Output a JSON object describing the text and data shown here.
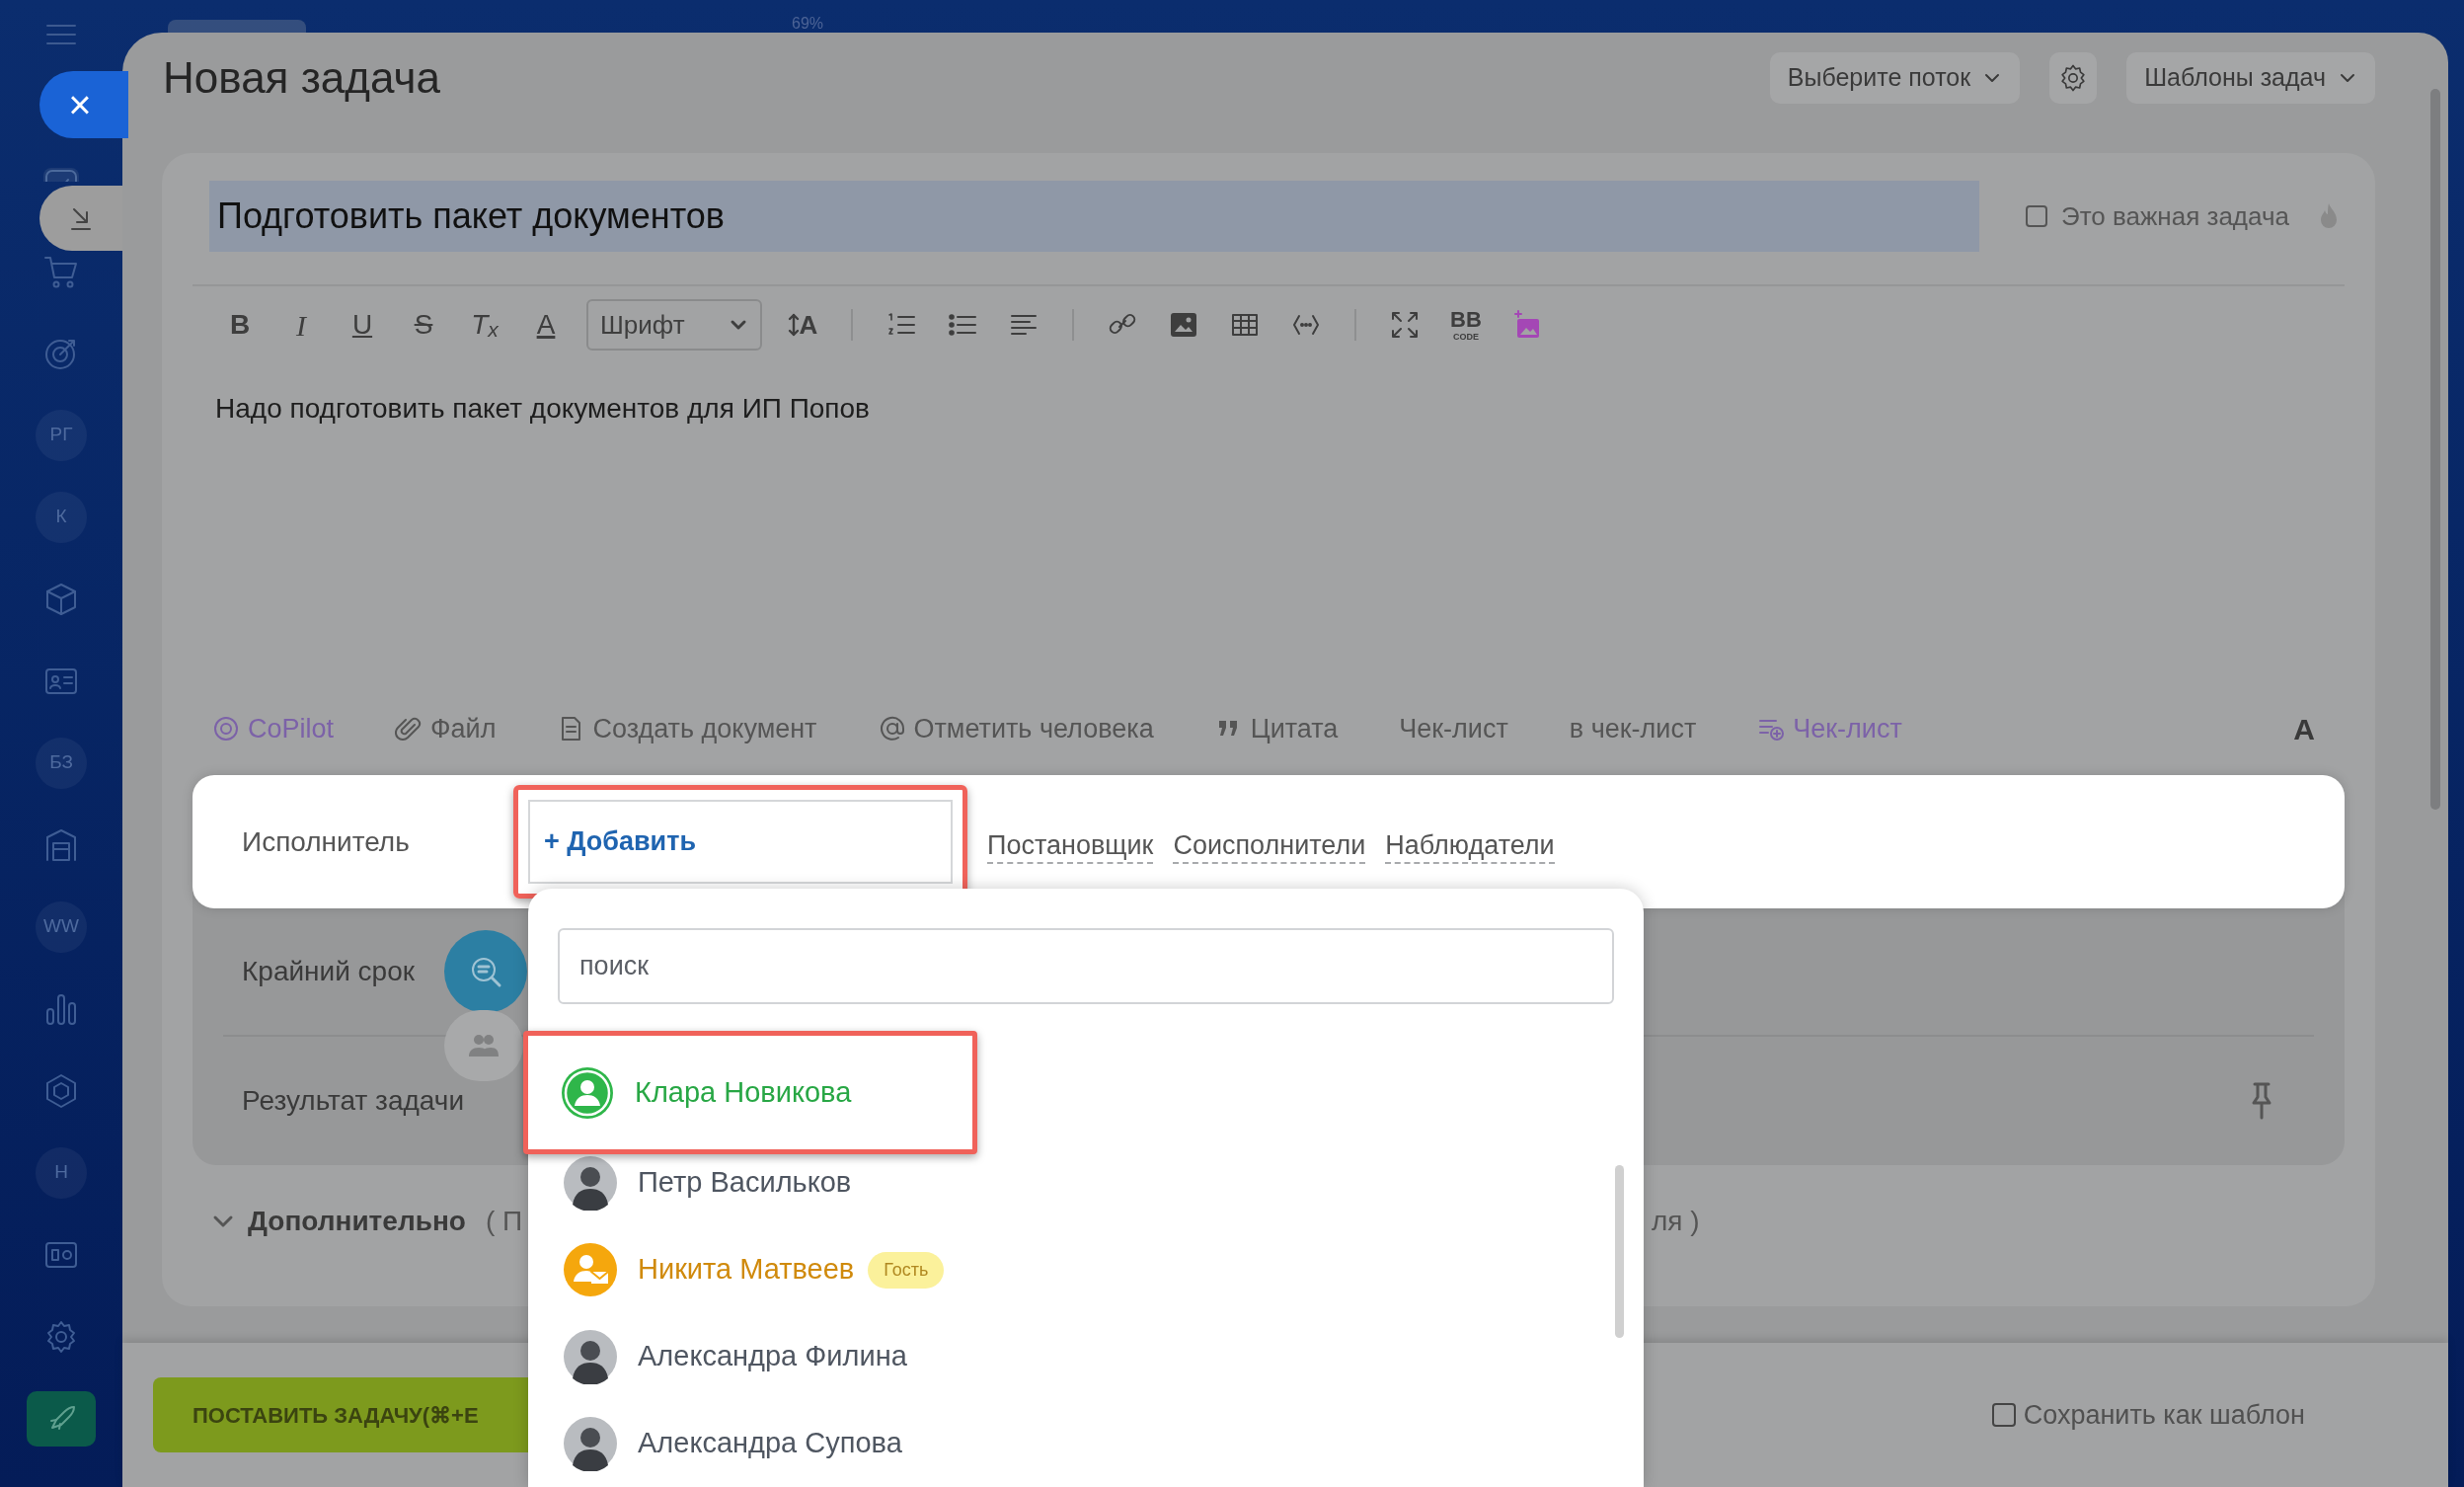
{
  "window": {
    "title": "Новая задача",
    "zoom": "69%"
  },
  "side_buttons": [
    {
      "kind": "close",
      "label": "×"
    },
    {
      "kind": "minimize"
    }
  ],
  "sidebar": {
    "items": [
      {
        "kind": "tasks"
      },
      {
        "kind": "cart"
      },
      {
        "kind": "target"
      },
      {
        "kind": "initials",
        "label": "РГ"
      },
      {
        "kind": "initials",
        "label": "К"
      },
      {
        "kind": "cube"
      },
      {
        "kind": "card"
      },
      {
        "kind": "initials",
        "label": "БЗ"
      },
      {
        "kind": "warehouse"
      },
      {
        "kind": "initials",
        "label": "WW"
      },
      {
        "kind": "chart"
      },
      {
        "kind": "hexagon"
      },
      {
        "kind": "initials",
        "label": "Н"
      },
      {
        "kind": "board"
      },
      {
        "kind": "settings"
      },
      {
        "kind": "rocket"
      }
    ]
  },
  "header_buttons": [
    {
      "kind": "dropdown",
      "label": "Выберите поток"
    },
    {
      "kind": "settings"
    },
    {
      "kind": "dropdown",
      "label": "Шаблоны задач"
    }
  ],
  "task": {
    "title": "Подготовить пакет документов",
    "important": {
      "label": "Это важная задача",
      "checked": false
    },
    "description": "Надо подготовить пакет документов для ИП Попов"
  },
  "editor_toolbar": [
    {
      "kind": "bold",
      "label": "B"
    },
    {
      "kind": "italic",
      "label": "I"
    },
    {
      "kind": "underline",
      "label": "U"
    },
    {
      "kind": "strike",
      "label": "S"
    },
    {
      "kind": "clear",
      "label": "T$_{x}$"
    },
    {
      "kind": "color",
      "label": "A"
    },
    {
      "kind": "select",
      "label": "Шрифт"
    },
    {
      "kind": "size",
      "label": "A"
    },
    {
      "kind": "sep"
    },
    {
      "kind": "ol"
    },
    {
      "kind": "ul"
    },
    {
      "kind": "align"
    },
    {
      "kind": "sep"
    },
    {
      "kind": "link"
    },
    {
      "kind": "image"
    },
    {
      "kind": "table"
    },
    {
      "kind": "code"
    },
    {
      "kind": "sep"
    },
    {
      "kind": "fullscreen"
    },
    {
      "kind": "bbcode",
      "label": "BB",
      "sublabel": "CODE"
    },
    {
      "kind": "magic"
    }
  ],
  "attach_bar": [
    {
      "kind": "copilot",
      "label": "CoPilot"
    },
    {
      "kind": "file",
      "label": "Файл"
    },
    {
      "kind": "document",
      "label": "Создать документ"
    },
    {
      "kind": "mention",
      "label": "Отметить человека"
    },
    {
      "kind": "quote",
      "label": "Цитата"
    },
    {
      "kind": "plain",
      "label": "Чек-лист"
    },
    {
      "kind": "plain",
      "label": "в чек-лист"
    },
    {
      "kind": "checklist",
      "label": "Чек-лист"
    },
    {
      "kind": "format",
      "label": "A"
    }
  ],
  "assignee": {
    "label": "Исполнитель",
    "add_button": "+ Добавить",
    "highlighted": true,
    "roles": [
      "Постановщик",
      "Соисполнители",
      "Наблюдатели"
    ]
  },
  "fields": [
    {
      "label": "Крайний срок"
    },
    {
      "label": "Результат задачи"
    }
  ],
  "more": {
    "label": "Дополнительно",
    "hint_start": "( П",
    "hint_end": "ля )"
  },
  "footer": {
    "submit": "ПОСТАВИТЬ ЗАДАЧУ(⌘+E",
    "save_template": {
      "label": "Сохранить как шаблон",
      "checked": false
    }
  },
  "user_picker": {
    "search_placeholder": "поиск",
    "users": [
      {
        "name": "Клара Новикова",
        "kind": "employee",
        "highlighted": true
      },
      {
        "name": "Петр Васильков",
        "kind": "photo",
        "highlighted": false
      },
      {
        "name": "Никита Матвеев",
        "kind": "guest",
        "badge": "Гость",
        "highlighted": false
      },
      {
        "name": "Александра Филина",
        "kind": "photo",
        "highlighted": false
      },
      {
        "name": "Александра Супова",
        "kind": "photo",
        "highlighted": false
      }
    ]
  }
}
